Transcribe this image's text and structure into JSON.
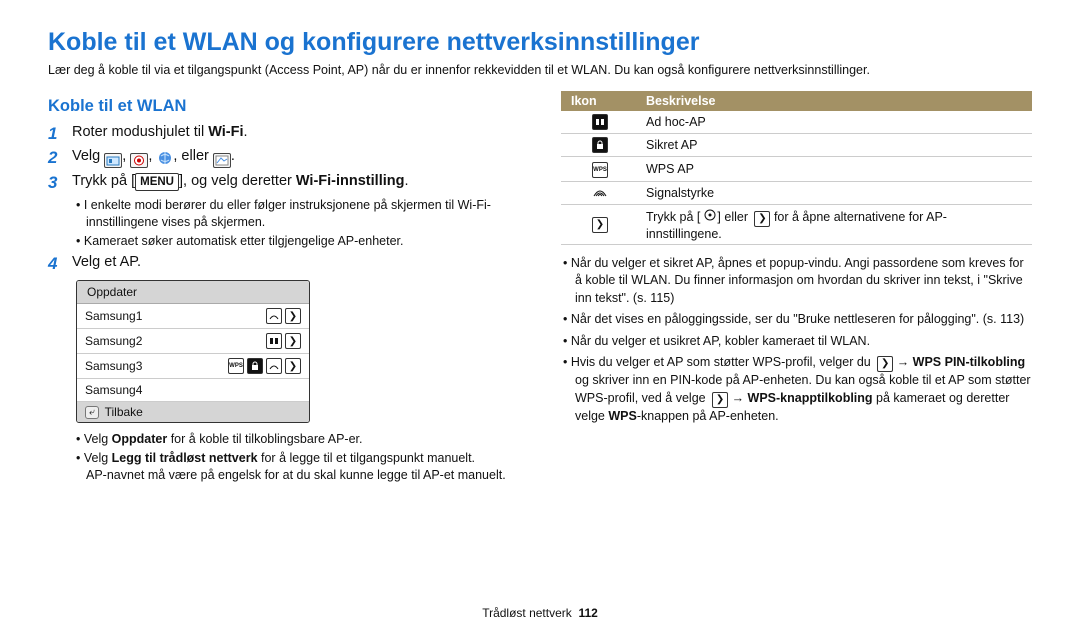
{
  "title": "Koble til et WLAN og konfigurere nettverksinnstillinger",
  "intro": "Lær deg å koble til via et tilgangspunkt (Access Point, AP) når du er innenfor rekkevidden til et WLAN. Du kan også konfigurere nettverksinnstillinger.",
  "section_heading": "Koble til et WLAN",
  "steps": {
    "n1": "1",
    "s1_a": "Roter modushjulet til ",
    "s1_wifi": "Wi-Fi",
    "s1_b": ".",
    "n2": "2",
    "s2_a": "Velg ",
    "s2_b": ", ",
    "s2_c": ", ",
    "s2_d": ", eller ",
    "s2_e": ".",
    "n3": "3",
    "s3_a": "Trykk på [",
    "s3_menu": "MENU",
    "s3_b": "], og velg deretter ",
    "s3_bold": "Wi-Fi-innstilling",
    "s3_c": ".",
    "n4": "4",
    "s4": "Velg et AP."
  },
  "sub_after_3": [
    "I enkelte modi berører du eller følger instruksjonene på skjermen til Wi-Fi-innstillingene vises på skjermen.",
    "Kameraet søker automatisk etter tilgjengelige AP-enheter."
  ],
  "ap_list": {
    "header": "Oppdater",
    "rows": [
      "Samsung1",
      "Samsung2",
      "Samsung3",
      "Samsung4"
    ],
    "back": "Tilbake"
  },
  "sub_after_list": {
    "a_pre": "Velg ",
    "a_bold": "Oppdater",
    "a_post": " for å koble til tilkoblingsbare AP-er.",
    "b_pre": "Velg ",
    "b_bold": "Legg til trådløst nettverk",
    "b_mid": " for å legge til et tilgangspunkt manuelt.",
    "b_line2": "AP-navnet må være på engelsk for at du skal kunne legge til AP-et manuelt."
  },
  "table": {
    "h1": "Ikon",
    "h2": "Beskrivelse",
    "r1": "Ad hoc-AP",
    "r2": "Sikret AP",
    "r3": "WPS AP",
    "r4": "Signalstyrke",
    "r5_a": "Trykk på [",
    "r5_b": "] eller ",
    "r5_c": " for å åpne alternativene for AP-innstillingene."
  },
  "right_bullets": {
    "b1": "Når du velger et sikret AP, åpnes et popup-vindu. Angi passordene som kreves for å koble til WLAN. Du finner informasjon om hvordan du skriver inn tekst, i \"Skrive inn tekst\". (s. 115)",
    "b2": "Når det vises en påloggingsside, ser du \"Bruke nettleseren for pålogging\". (s. 113)",
    "b3": "Når du velger et usikret AP, kobler kameraet til WLAN.",
    "b4_a": "Hvis du velger et AP som støtter WPS-profil, velger du ",
    "b4_b": " → ",
    "b4_bold1": "WPS PIN-tilkobling",
    "b4_c": " og skriver inn en PIN-kode på AP-enheten. Du kan også koble til et AP som støtter WPS-profil, ved å velge ",
    "b4_d": " → ",
    "b4_bold2": "WPS-knapptilkobling",
    "b4_e": " på kameraet og deretter velge ",
    "b4_bold3": "WPS",
    "b4_f": "-knappen på AP-enheten."
  },
  "footer": {
    "section": "Trådløst nettverk",
    "page": "112"
  }
}
